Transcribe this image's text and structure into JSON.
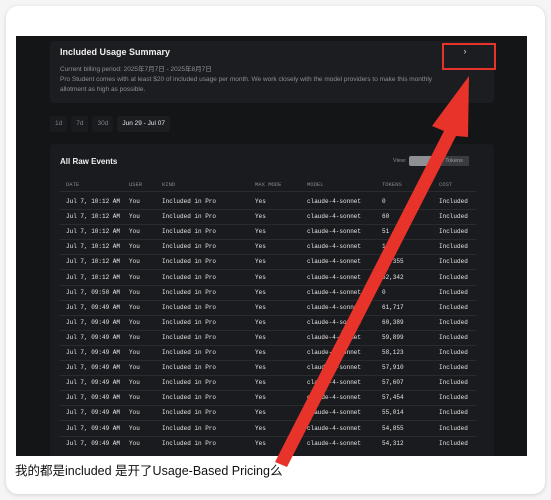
{
  "summary": {
    "title": "Included Usage Summary",
    "billing_period": "Current billing period: 2025年7月7日 - 2025年8月7日",
    "description": "Pro Student comes with at least $20 of included usage per month. We work closely with the model providers to make this monthly allotment as high as possible.",
    "chevron": "›"
  },
  "range_tabs": [
    {
      "label": "1d"
    },
    {
      "label": "7d"
    },
    {
      "label": "30d"
    },
    {
      "label": "Jun 29 - Jul 07",
      "active": true
    }
  ],
  "events": {
    "title": "All Raw Events",
    "view_label": "View:",
    "view_options": [
      "Cost",
      "Tokens"
    ],
    "columns": [
      "DATE",
      "USER",
      "KIND",
      "MAX MODE",
      "MODEL",
      "TOKENS",
      "COST"
    ],
    "rows": [
      [
        "Jul 7, 10:12 AM",
        "You",
        "Included in Pro",
        "Yes",
        "claude-4-sonnet",
        "0",
        "Included"
      ],
      [
        "Jul 7, 10:12 AM",
        "You",
        "Included in Pro",
        "Yes",
        "claude-4-sonnet",
        "60",
        "Included"
      ],
      [
        "Jul 7, 10:12 AM",
        "You",
        "Included in Pro",
        "Yes",
        "claude-4-sonnet",
        "51",
        "Included"
      ],
      [
        "Jul 7, 10:12 AM",
        "You",
        "Included in Pro",
        "Yes",
        "claude-4-sonnet",
        "1,117",
        "Included"
      ],
      [
        "Jul 7, 10:12 AM",
        "You",
        "Included in Pro",
        "Yes",
        "claude-4-sonnet",
        "66,355",
        "Included"
      ],
      [
        "Jul 7, 10:12 AM",
        "You",
        "Included in Pro",
        "Yes",
        "claude-4-sonnet",
        "62,342",
        "Included"
      ],
      [
        "Jul 7, 09:50 AM",
        "You",
        "Included in Pro",
        "Yes",
        "claude-4-sonnet",
        "0",
        "Included"
      ],
      [
        "Jul 7, 09:49 AM",
        "You",
        "Included in Pro",
        "Yes",
        "claude-4-sonnet",
        "61,717",
        "Included"
      ],
      [
        "Jul 7, 09:49 AM",
        "You",
        "Included in Pro",
        "Yes",
        "claude-4-sonnet",
        "60,389",
        "Included"
      ],
      [
        "Jul 7, 09:49 AM",
        "You",
        "Included in Pro",
        "Yes",
        "claude-4-sonnet",
        "59,899",
        "Included"
      ],
      [
        "Jul 7, 09:49 AM",
        "You",
        "Included in Pro",
        "Yes",
        "claude-4-sonnet",
        "58,123",
        "Included"
      ],
      [
        "Jul 7, 09:49 AM",
        "You",
        "Included in Pro",
        "Yes",
        "claude-4-sonnet",
        "57,910",
        "Included"
      ],
      [
        "Jul 7, 09:49 AM",
        "You",
        "Included in Pro",
        "Yes",
        "claude-4-sonnet",
        "57,607",
        "Included"
      ],
      [
        "Jul 7, 09:49 AM",
        "You",
        "Included in Pro",
        "Yes",
        "claude-4-sonnet",
        "57,454",
        "Included"
      ],
      [
        "Jul 7, 09:49 AM",
        "You",
        "Included in Pro",
        "Yes",
        "claude-4-sonnet",
        "55,014",
        "Included"
      ],
      [
        "Jul 7, 09:49 AM",
        "You",
        "Included in Pro",
        "Yes",
        "claude-4-sonnet",
        "54,855",
        "Included"
      ],
      [
        "Jul 7, 09:49 AM",
        "You",
        "Included in Pro",
        "Yes",
        "claude-4-sonnet",
        "54,312",
        "Included"
      ]
    ]
  },
  "annotation": {
    "color": "#e8332a"
  },
  "caption": "我的都是included 是开了Usage-Based Pricing么"
}
